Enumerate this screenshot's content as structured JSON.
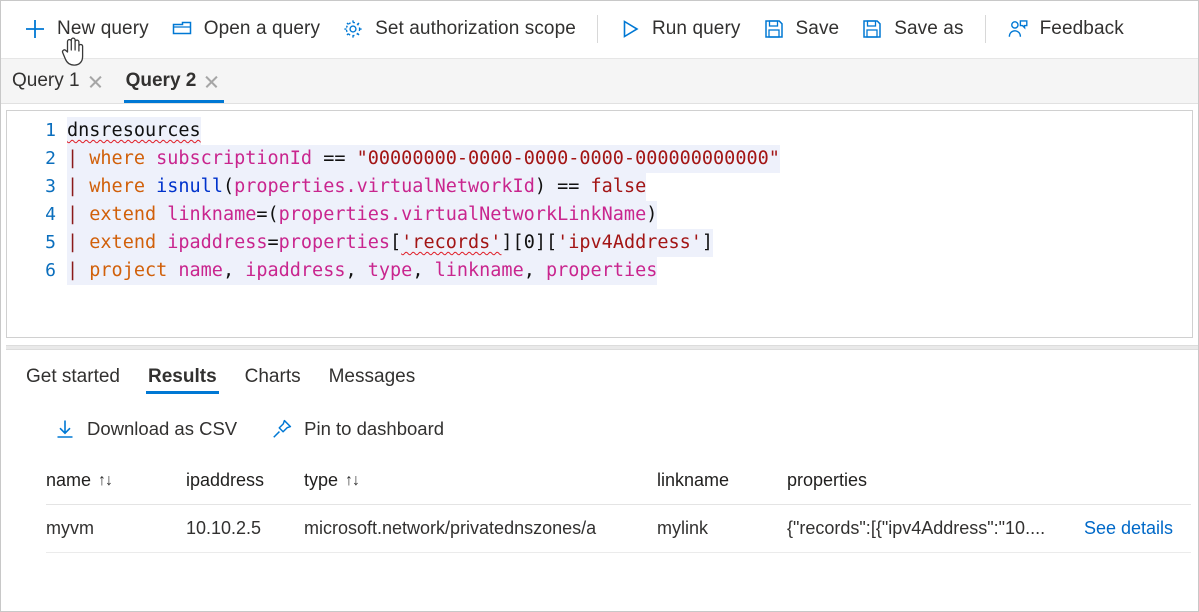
{
  "toolbar": {
    "buttons": [
      {
        "label": "New query",
        "icon": "plus-icon"
      },
      {
        "label": "Open a query",
        "icon": "folder-icon"
      },
      {
        "label": "Set authorization scope",
        "icon": "gear-icon"
      },
      {
        "label": "Run query",
        "icon": "play-icon"
      },
      {
        "label": "Save",
        "icon": "save-icon"
      },
      {
        "label": "Save as",
        "icon": "save-as-icon"
      },
      {
        "label": "Feedback",
        "icon": "feedback-icon"
      }
    ]
  },
  "query_tabs": [
    {
      "label": "Query 1",
      "active": false
    },
    {
      "label": "Query 2",
      "active": true
    }
  ],
  "editor": {
    "line_numbers": [
      "1",
      "2",
      "3",
      "4",
      "5",
      "6"
    ],
    "lines": [
      "dnsresources",
      "| where subscriptionId == \"00000000-0000-0000-0000-000000000000\"",
      "| where isnull(properties.virtualNetworkId) == false",
      "| extend linkname=(properties.virtualNetworkLinkName)",
      "| extend ipaddress=properties['records'][0]['ipv4Address']",
      "| project name, ipaddress, type, linkname, properties"
    ],
    "tokens": {
      "table": "dnsresources",
      "pipe": "|",
      "op_where": "where",
      "op_extend": "extend",
      "op_project": "project",
      "col_subscriptionId": "subscriptionId",
      "eqeq": "==",
      "subscription_value": "\"00000000-0000-0000-0000-000000000000\"",
      "fn_isnull": "isnull",
      "col_properties": "properties",
      "dot_virtualNetworkId": ".virtualNetworkId",
      "kw_false": "false",
      "col_linkname": "linkname",
      "dot_virtualNetworkLinkName": ".virtualNetworkLinkName",
      "col_ipaddress": "ipaddress",
      "str_records": "'records'",
      "num_zero": "0",
      "str_ipv4Address": "'ipv4Address'",
      "col_name": "name",
      "col_type": "type"
    }
  },
  "results": {
    "tabs": [
      {
        "label": "Get started",
        "active": false
      },
      {
        "label": "Results",
        "active": true
      },
      {
        "label": "Charts",
        "active": false
      },
      {
        "label": "Messages",
        "active": false
      }
    ],
    "actions": [
      {
        "label": "Download as CSV",
        "icon": "download-icon"
      },
      {
        "label": "Pin to dashboard",
        "icon": "pin-icon"
      }
    ],
    "table": {
      "columns": [
        {
          "label": "name",
          "sortable": true,
          "sort_icon": "↑↓"
        },
        {
          "label": "ipaddress",
          "sortable": false,
          "sort_icon": ""
        },
        {
          "label": "type",
          "sortable": true,
          "sort_icon": "↑↓"
        },
        {
          "label": "linkname",
          "sortable": false,
          "sort_icon": ""
        },
        {
          "label": "properties",
          "sortable": false,
          "sort_icon": ""
        }
      ],
      "rows": [
        {
          "name": "myvm",
          "ipaddress": "10.10.2.5",
          "type": "microsoft.network/privatednszones/a",
          "linkname": "mylink",
          "properties": "{\"records\":[{\"ipv4Address\":\"10....",
          "details_link": "See details"
        }
      ]
    }
  },
  "colors": {
    "accent": "#0078d4",
    "link": "#0069c8",
    "text": "#323130",
    "operator": "#d1600a",
    "column": "#c9258e",
    "function": "#0033cc",
    "string": "#a31515",
    "pipe": "#8b1a1a",
    "linenumber": "#0a6ebd"
  }
}
